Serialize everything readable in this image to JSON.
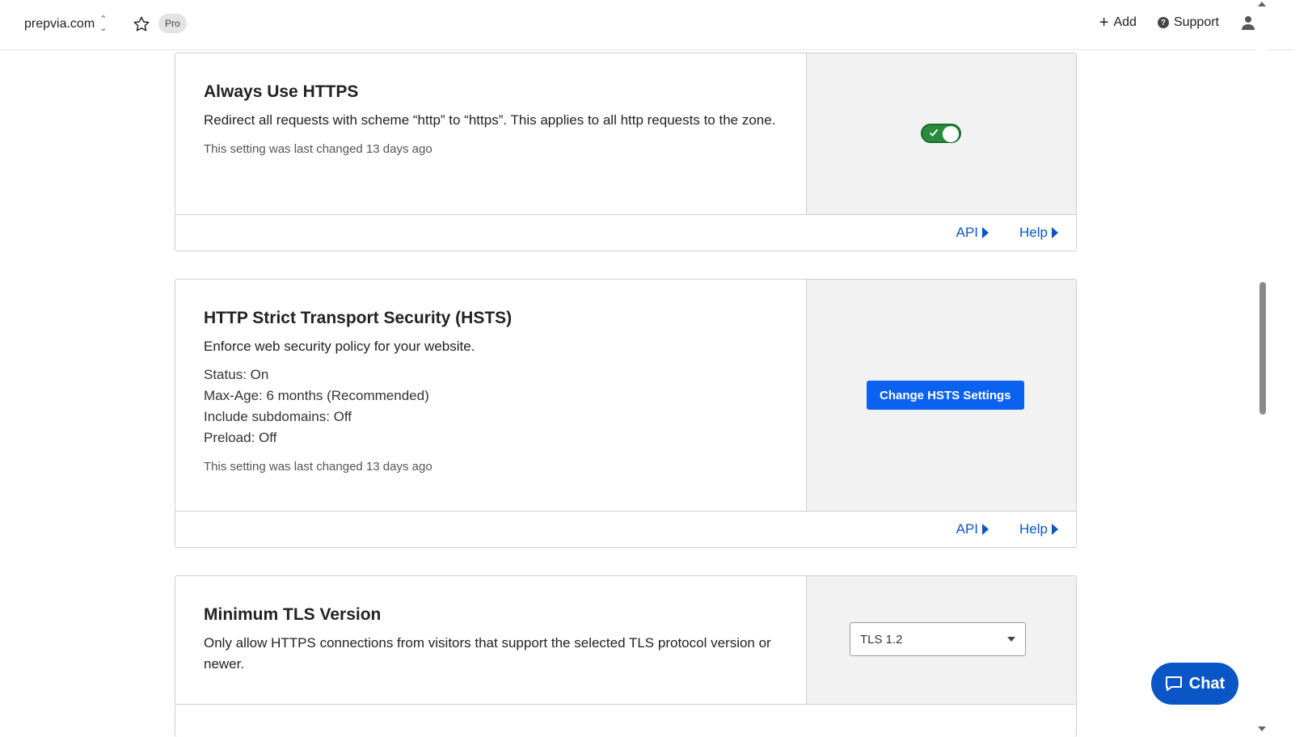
{
  "topbar": {
    "zone_name": "prepvia.com",
    "plan_badge": "Pro",
    "add_label": "Add",
    "support_label": "Support"
  },
  "cards": {
    "always_https": {
      "title": "Always Use HTTPS",
      "description": "Redirect all requests with scheme “http” to “https”. This applies to all http requests to the zone.",
      "last_changed": "This setting was last changed 13 days ago",
      "toggle_on": true,
      "api_label": "API",
      "help_label": "Help"
    },
    "hsts": {
      "title": "HTTP Strict Transport Security (HSTS)",
      "description": "Enforce web security policy for your website.",
      "status": "Status: On",
      "max_age": "Max-Age: 6 months (Recommended)",
      "include_subdomains": "Include subdomains: Off",
      "preload": "Preload: Off",
      "last_changed": "This setting was last changed 13 days ago",
      "button_label": "Change HSTS Settings",
      "api_label": "API",
      "help_label": "Help"
    },
    "min_tls": {
      "title": "Minimum TLS Version",
      "description": "Only allow HTTPS connections from visitors that support the selected TLS protocol version or newer.",
      "selected_value": "TLS 1.2"
    }
  },
  "chat": {
    "label": "Chat"
  },
  "colors": {
    "link": "#0a56c7",
    "primary_button": "#0b62f0",
    "toggle_on": "#2a8a3e"
  }
}
